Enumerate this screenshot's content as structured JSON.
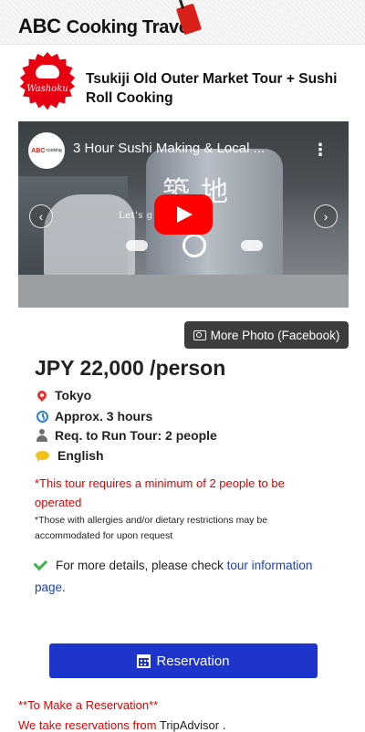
{
  "header": {
    "brand_abc": "ABC",
    "brand_rest": "Cooking Travel"
  },
  "badge": {
    "label": "Washoku"
  },
  "tour": {
    "title": "Tsukiji Old Outer Market Tour + Sushi Roll Cooking"
  },
  "video": {
    "channel_label_a": "ABC",
    "channel_label_b": "cooking",
    "title": "3 Hour Sushi Making & Local ...",
    "kanji_left": "築",
    "kanji_right": "地",
    "subtitle": "Let's g         Market!",
    "prev_label": "‹",
    "next_label": "›",
    "menu_label": "⋮"
  },
  "more_photo": {
    "label": "More Photo (Facebook)"
  },
  "price": "JPY 22,000 /person",
  "info": {
    "location": "Tokyo",
    "duration": "Approx. 3 hours",
    "requirement": "Req. to Run Tour: 2 people",
    "language": "English"
  },
  "notes": {
    "minimum": "*This tour requires a minimum of 2 people to  be operated",
    "allergies": "*Those with allergies and/or dietary restrictions may be accommodated for upon request"
  },
  "details": {
    "prefix": "For more details, please check ",
    "link_text": "tour information page",
    "suffix": "."
  },
  "reservation": {
    "button_label": "Reservation"
  },
  "reservation_note": {
    "heading": "**To Make a Reservation**",
    "line_prefix": "We take reservations from ",
    "line_link": "TripAdvisor",
    "line_suffix": " ."
  },
  "colors": {
    "brand_red": "#d8211b",
    "reserve_blue": "#1e35cc",
    "notice_red": "#e00000",
    "link_blue": "#1a3fc7",
    "check_green": "#3bb34a"
  },
  "icons": [
    "camera-icon",
    "location-pin-icon",
    "clock-icon",
    "user-icon",
    "speech-bubble-icon",
    "checkmark-icon",
    "calendar-icon",
    "play-icon"
  ]
}
